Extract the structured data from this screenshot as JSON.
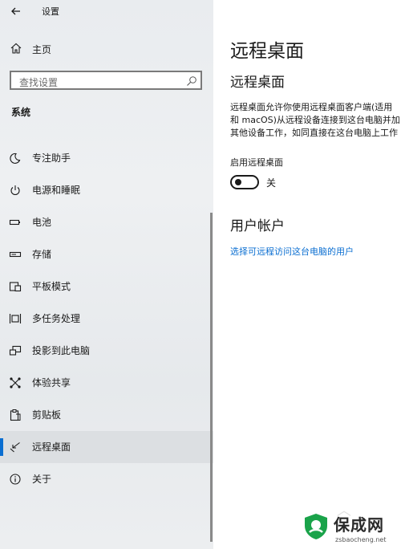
{
  "window": {
    "title": "设置"
  },
  "sidebar": {
    "home_label": "主页",
    "search_placeholder": "查找设置",
    "section_title": "系统",
    "items": [
      {
        "label": "专注助手",
        "icon": "moon-icon"
      },
      {
        "label": "电源和睡眠",
        "icon": "power-icon"
      },
      {
        "label": "电池",
        "icon": "battery-icon"
      },
      {
        "label": "存储",
        "icon": "storage-icon"
      },
      {
        "label": "平板模式",
        "icon": "tablet-mode-icon"
      },
      {
        "label": "多任务处理",
        "icon": "multitasking-icon"
      },
      {
        "label": "投影到此电脑",
        "icon": "project-icon"
      },
      {
        "label": "体验共享",
        "icon": "share-icon"
      },
      {
        "label": "剪贴板",
        "icon": "clipboard-icon"
      },
      {
        "label": "远程桌面",
        "icon": "remote-desktop-icon",
        "active": true
      },
      {
        "label": "关于",
        "icon": "info-icon"
      }
    ]
  },
  "main": {
    "page_title": "远程桌面",
    "section_title": "远程桌面",
    "description_lines": [
      "远程桌面允许你使用远程桌面客户端(适用",
      "和 macOS)从远程设备连接到这台电脑并加",
      "其他设备工作，如同直接在这台电脑上工作"
    ],
    "toggle_label": "启用远程桌面",
    "toggle_state": "关",
    "toggle_on": false,
    "account_title": "用户帐户",
    "account_link": "选择可远程访问这台电脑的用户"
  },
  "watermark": {
    "name": "保成网",
    "domain": "zsbaocheng.net"
  },
  "colors": {
    "accent": "#0a6ed1",
    "sidebar_bg": "#eceef0",
    "active_bg": "#dcdfe2",
    "watermark_logo": "#1aa34a"
  }
}
